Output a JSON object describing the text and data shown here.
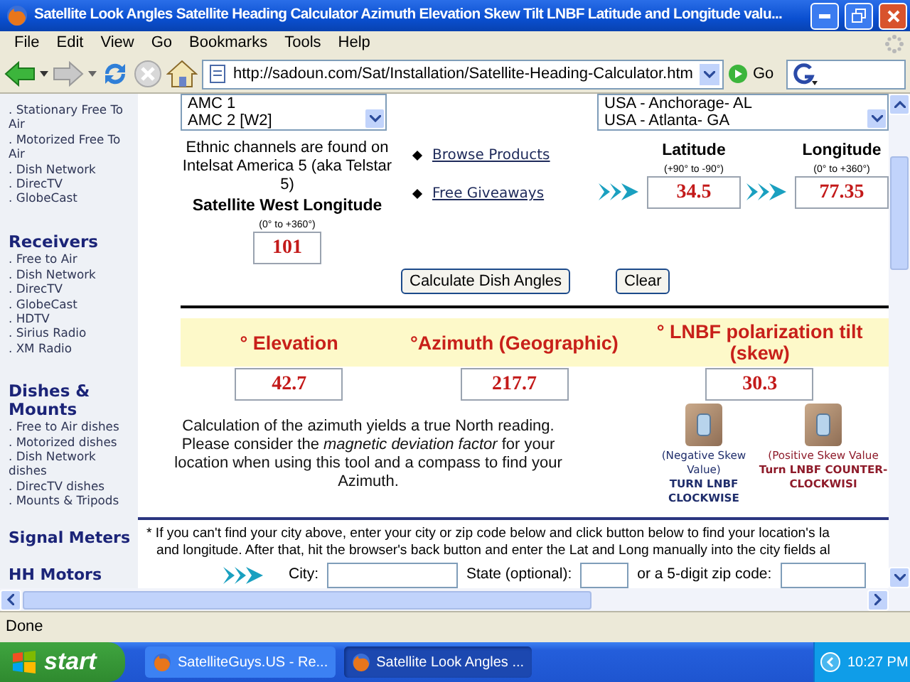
{
  "window": {
    "title": "Satellite Look Angles Satellite Heading Calculator Azimuth Elevation Skew Tilt LNBF Latitude and Longitude valu..."
  },
  "menu": [
    "File",
    "Edit",
    "View",
    "Go",
    "Bookmarks",
    "Tools",
    "Help"
  ],
  "toolbar": {
    "address": "http://sadoun.com/Sat/Installation/Satellite-Heading-Calculator.htm",
    "go_label": "Go"
  },
  "sidebar": {
    "top_items": [
      ". Stationary Free To Air",
      ". Motorized Free To Air",
      ". Dish Network",
      ". DirecTV",
      ". GlobeCast"
    ],
    "sections": [
      {
        "heading": "Receivers",
        "items": [
          ". Free to Air",
          ". Dish Network",
          ". DirecTV",
          ". GlobeCast",
          ". HDTV",
          ". Sirius Radio",
          ". XM Radio"
        ]
      },
      {
        "heading": "Dishes & Mounts",
        "items": [
          ". Free to Air dishes",
          ". Motorized dishes",
          ". Dish Network dishes",
          ". DirecTV dishes",
          ". Mounts & Tripods"
        ]
      },
      {
        "heading": "Signal Meters"
      },
      {
        "heading": "HH Motors"
      }
    ]
  },
  "satellite_list": {
    "options": [
      "AMC 1",
      "AMC 2 [W2]"
    ]
  },
  "city_list": {
    "options": [
      "USA - Anchorage- AL",
      "USA - Atlanta- GA"
    ]
  },
  "ethnic_note": "Ethnic channels are found on Intelsat America 5 (aka Telstar 5)",
  "satellite_longitude": {
    "label": "Satellite West Longitude",
    "range": "(0° to +360°)",
    "value": "101"
  },
  "links": [
    "Browse Products",
    "Free Giveaways"
  ],
  "coordinates": [
    {
      "label": "Latitude",
      "range": "(+90° to -90°)",
      "value": "34.5"
    },
    {
      "label": "Longitude",
      "range": "(0° to +360°)",
      "value": "77.35"
    }
  ],
  "buttons": [
    "Calculate Dish Angles",
    "Clear"
  ],
  "results": [
    {
      "label": "° Elevation",
      "value": "42.7"
    },
    {
      "label": "°Azimuth (Geographic)",
      "value": "217.7"
    },
    {
      "label": "° LNBF polarization tilt (skew)",
      "value": "30.3"
    }
  ],
  "azimuth_note": "Calculation of the azimuth yields a true North reading. Please consider the *magnetic deviation factor* for your location when using this tool and a compass to find your Azimuth.",
  "skew_hints": [
    {
      "caption": "(Negative Skew Value)",
      "instruction": "TURN LNBF CLOCKWISE",
      "color": "#1f2d6b"
    },
    {
      "caption": "(Positive Skew Value",
      "instruction": "Turn LNBF COUNTER-CLOCKWISI",
      "color": "#8e1b2a"
    }
  ],
  "city_search": {
    "instruction_lines": [
      "* If you can't find your city above, enter your city or zip code below and click button below to find your location's la",
      "and longitude. After that, hit the browser's back button and enter the Lat and Long manually into the city fields al"
    ],
    "fields": [
      "City:",
      "State (optional):",
      "or a 5-digit zip code:"
    ]
  },
  "status_bar": "Done",
  "taskbar": {
    "start": "start",
    "tasks": [
      {
        "label": "SatelliteGuys.US - Re...",
        "selected": false
      },
      {
        "label": "Satellite Look Angles ...",
        "selected": true
      }
    ],
    "clock": "10:27 PM"
  }
}
